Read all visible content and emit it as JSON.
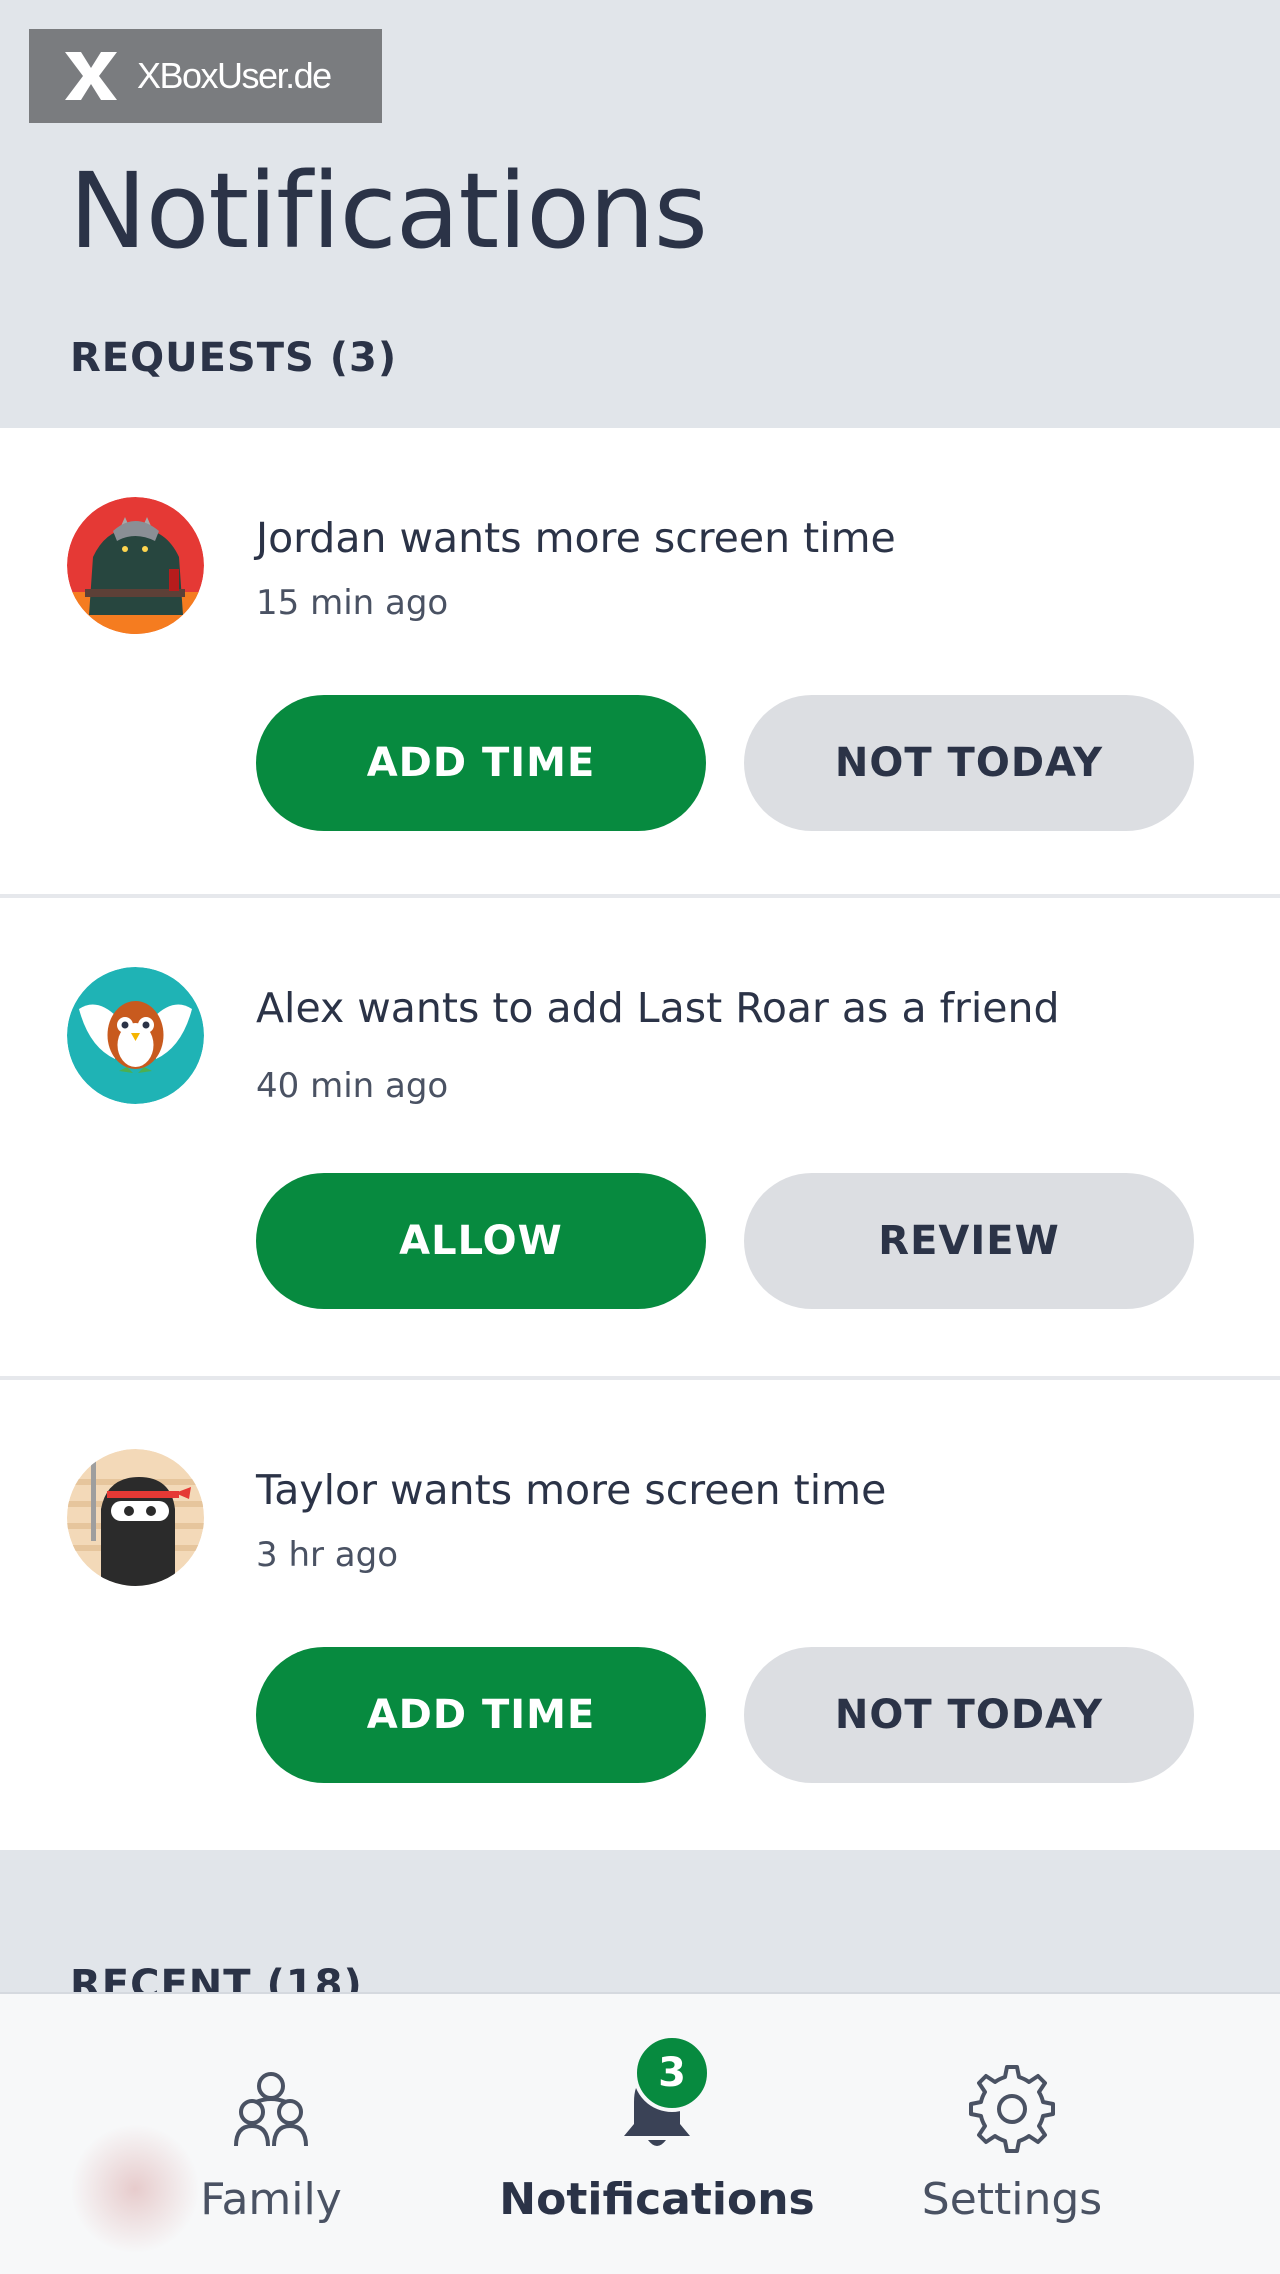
{
  "watermark": {
    "text": "XBoxUser.de"
  },
  "header": {
    "title": "Notifications"
  },
  "requests": {
    "label": "REQUESTS (3)",
    "items": [
      {
        "avatar": "monster-avatar",
        "text": "Jordan wants more screen time",
        "time": "15 min ago",
        "primary_label": "ADD TIME",
        "secondary_label": "NOT TODAY"
      },
      {
        "avatar": "owl-avatar",
        "text": "Alex wants to add Last Roar as a friend",
        "time": "40 min ago",
        "primary_label": "ALLOW",
        "secondary_label": "REVIEW"
      },
      {
        "avatar": "ninja-avatar",
        "text": "Taylor wants more screen time",
        "time": "3 hr ago",
        "primary_label": "ADD TIME",
        "secondary_label": "NOT TODAY"
      }
    ]
  },
  "recent": {
    "label": "RECENT (18)"
  },
  "bottom_nav": {
    "items": [
      {
        "label": "Family",
        "icon": "family-icon"
      },
      {
        "label": "Notifications",
        "icon": "bell-icon",
        "active": true,
        "badge": "3"
      },
      {
        "label": "Settings",
        "icon": "gear-icon"
      }
    ]
  },
  "colors": {
    "primary_green": "#078a3f",
    "background": "#e1e5ea",
    "text_dark": "#2b3347",
    "secondary_button": "#dcdee2"
  }
}
